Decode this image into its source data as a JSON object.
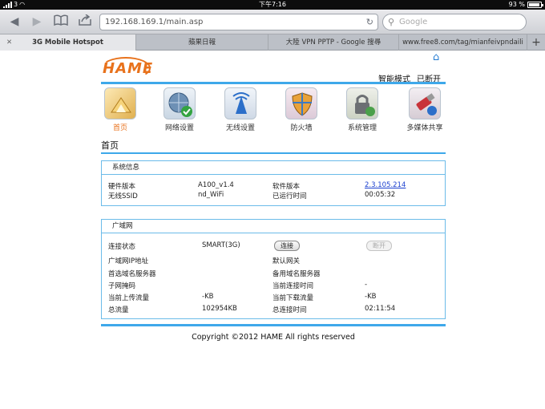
{
  "status_bar": {
    "carrier": "3",
    "time": "下午7:16",
    "battery": "93 %",
    "battery_level": 0.93
  },
  "browser": {
    "url": "192.168.169.1/main.asp",
    "search_placeholder": "Google",
    "tabs": [
      {
        "label": "3G Mobile Hotspot",
        "active": true
      },
      {
        "label": "蘋果日報",
        "active": false
      },
      {
        "label": "大陸 VPN PPTP - Google 搜尋",
        "active": false
      },
      {
        "label": "www.free8.com/tag/mianfeivpndaili",
        "active": false
      }
    ]
  },
  "header": {
    "logo": "HAME",
    "mode": "智能模式",
    "connection": "已断开"
  },
  "nav": [
    {
      "label": "首页",
      "icon": "home-icon"
    },
    {
      "label": "网络设置",
      "icon": "globe-check-icon"
    },
    {
      "label": "无线设置",
      "icon": "wireless-tower-icon"
    },
    {
      "label": "防火墙",
      "icon": "shield-icon"
    },
    {
      "label": "系统管理",
      "icon": "lock-gear-icon"
    },
    {
      "label": "多媒体共享",
      "icon": "usb-share-icon"
    }
  ],
  "page_title": "首页",
  "system_info": {
    "title": "系统信息",
    "hw_label": "硬件版本",
    "hw_value": "A100_v1.4",
    "sw_label": "软件版本",
    "sw_value": "2.3.105.214",
    "ssid_label": "无线SSID",
    "ssid_value": "nd_WiFi",
    "uptime_label": "已运行时间",
    "uptime_value": "00:05:32"
  },
  "wan": {
    "title": "广域网",
    "status_label": "连接状态",
    "status_value": "SMART(3G)",
    "connect_btn": "连接",
    "disconnect_btn": "断开",
    "ip_label": "广域网IP地址",
    "gateway_label": "默认网关",
    "dns1_label": "首选域名服务器",
    "dns2_label": "备用域名服务器",
    "mask_label": "子网掩码",
    "conn_time_label": "当前连接时间",
    "conn_time_value": "-",
    "up_label": "当前上传流量",
    "up_value": "-KB",
    "down_label": "当前下载流量",
    "down_value": "-KB",
    "total_label": "总流量",
    "total_value": "102954KB",
    "total_time_label": "总连接时间",
    "total_time_value": "02:11:54"
  },
  "footer": {
    "copyright": "Copyright ©2012 HAME All rights reserved"
  }
}
